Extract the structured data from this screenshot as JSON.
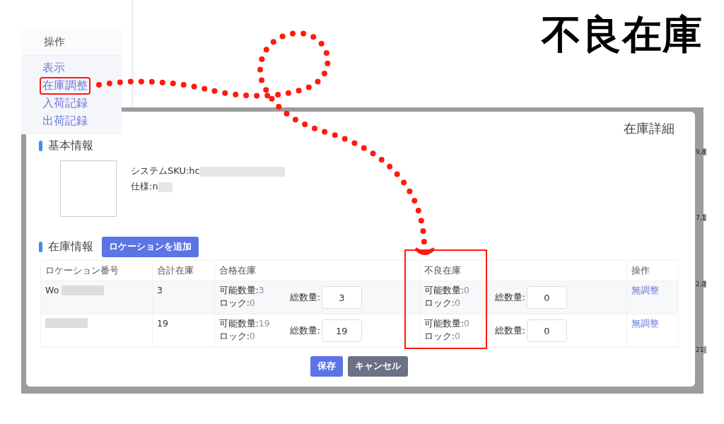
{
  "annotation": {
    "title": "不良在庫"
  },
  "menu": {
    "header": "操作",
    "items": [
      {
        "label": "表示",
        "highlighted": false
      },
      {
        "label": "在庫調整",
        "highlighted": true
      },
      {
        "label": "入荷記録",
        "highlighted": false
      },
      {
        "label": "出荷記録",
        "highlighted": false
      }
    ]
  },
  "background_cells": [
    "9,8",
    "7,1",
    "2,0",
    "21"
  ],
  "modal": {
    "title": "在庫詳細",
    "basic_section": "基本情報",
    "sku_label": "システムSKU:hc",
    "spec_label": "仕様:n",
    "stock_section": "在庫情報",
    "add_button": "ロケーションを追加",
    "columns": [
      {
        "label": "ロケーション番号",
        "highlighted": false
      },
      {
        "label": "合計在庫",
        "highlighted": false
      },
      {
        "label": "合格在庫",
        "highlighted": false
      },
      {
        "label": "不良在庫",
        "highlighted": true
      },
      {
        "label": "操作",
        "highlighted": false
      }
    ],
    "rows": [
      {
        "location": "Wo",
        "total": "3",
        "good": {
          "available_label": "可能数量:",
          "available": "3",
          "lock_label": "ロック:",
          "lock": "0",
          "total_label": "総数量:",
          "total_value": "3"
        },
        "bad": {
          "available_label": "可能数量:",
          "available": "0",
          "lock_label": "ロック:",
          "lock": "0",
          "total_label": "総数量:",
          "total_value": "0"
        },
        "action": "無調整"
      },
      {
        "total": "19",
        "good": {
          "available_label": "可能数量:",
          "available": "19",
          "lock_label": "ロック:",
          "lock": "0",
          "total_label": "総数量:",
          "total_value": "19"
        },
        "bad": {
          "available_label": "可能数量:",
          "available": "0",
          "lock_label": "ロック:",
          "lock": "0",
          "total_label": "総数量:",
          "total_value": "0"
        },
        "action": "無調整"
      }
    ],
    "buttons": [
      {
        "label": "保存",
        "kind": "primary"
      },
      {
        "label": "キャンセル",
        "kind": "secondary"
      }
    ]
  }
}
